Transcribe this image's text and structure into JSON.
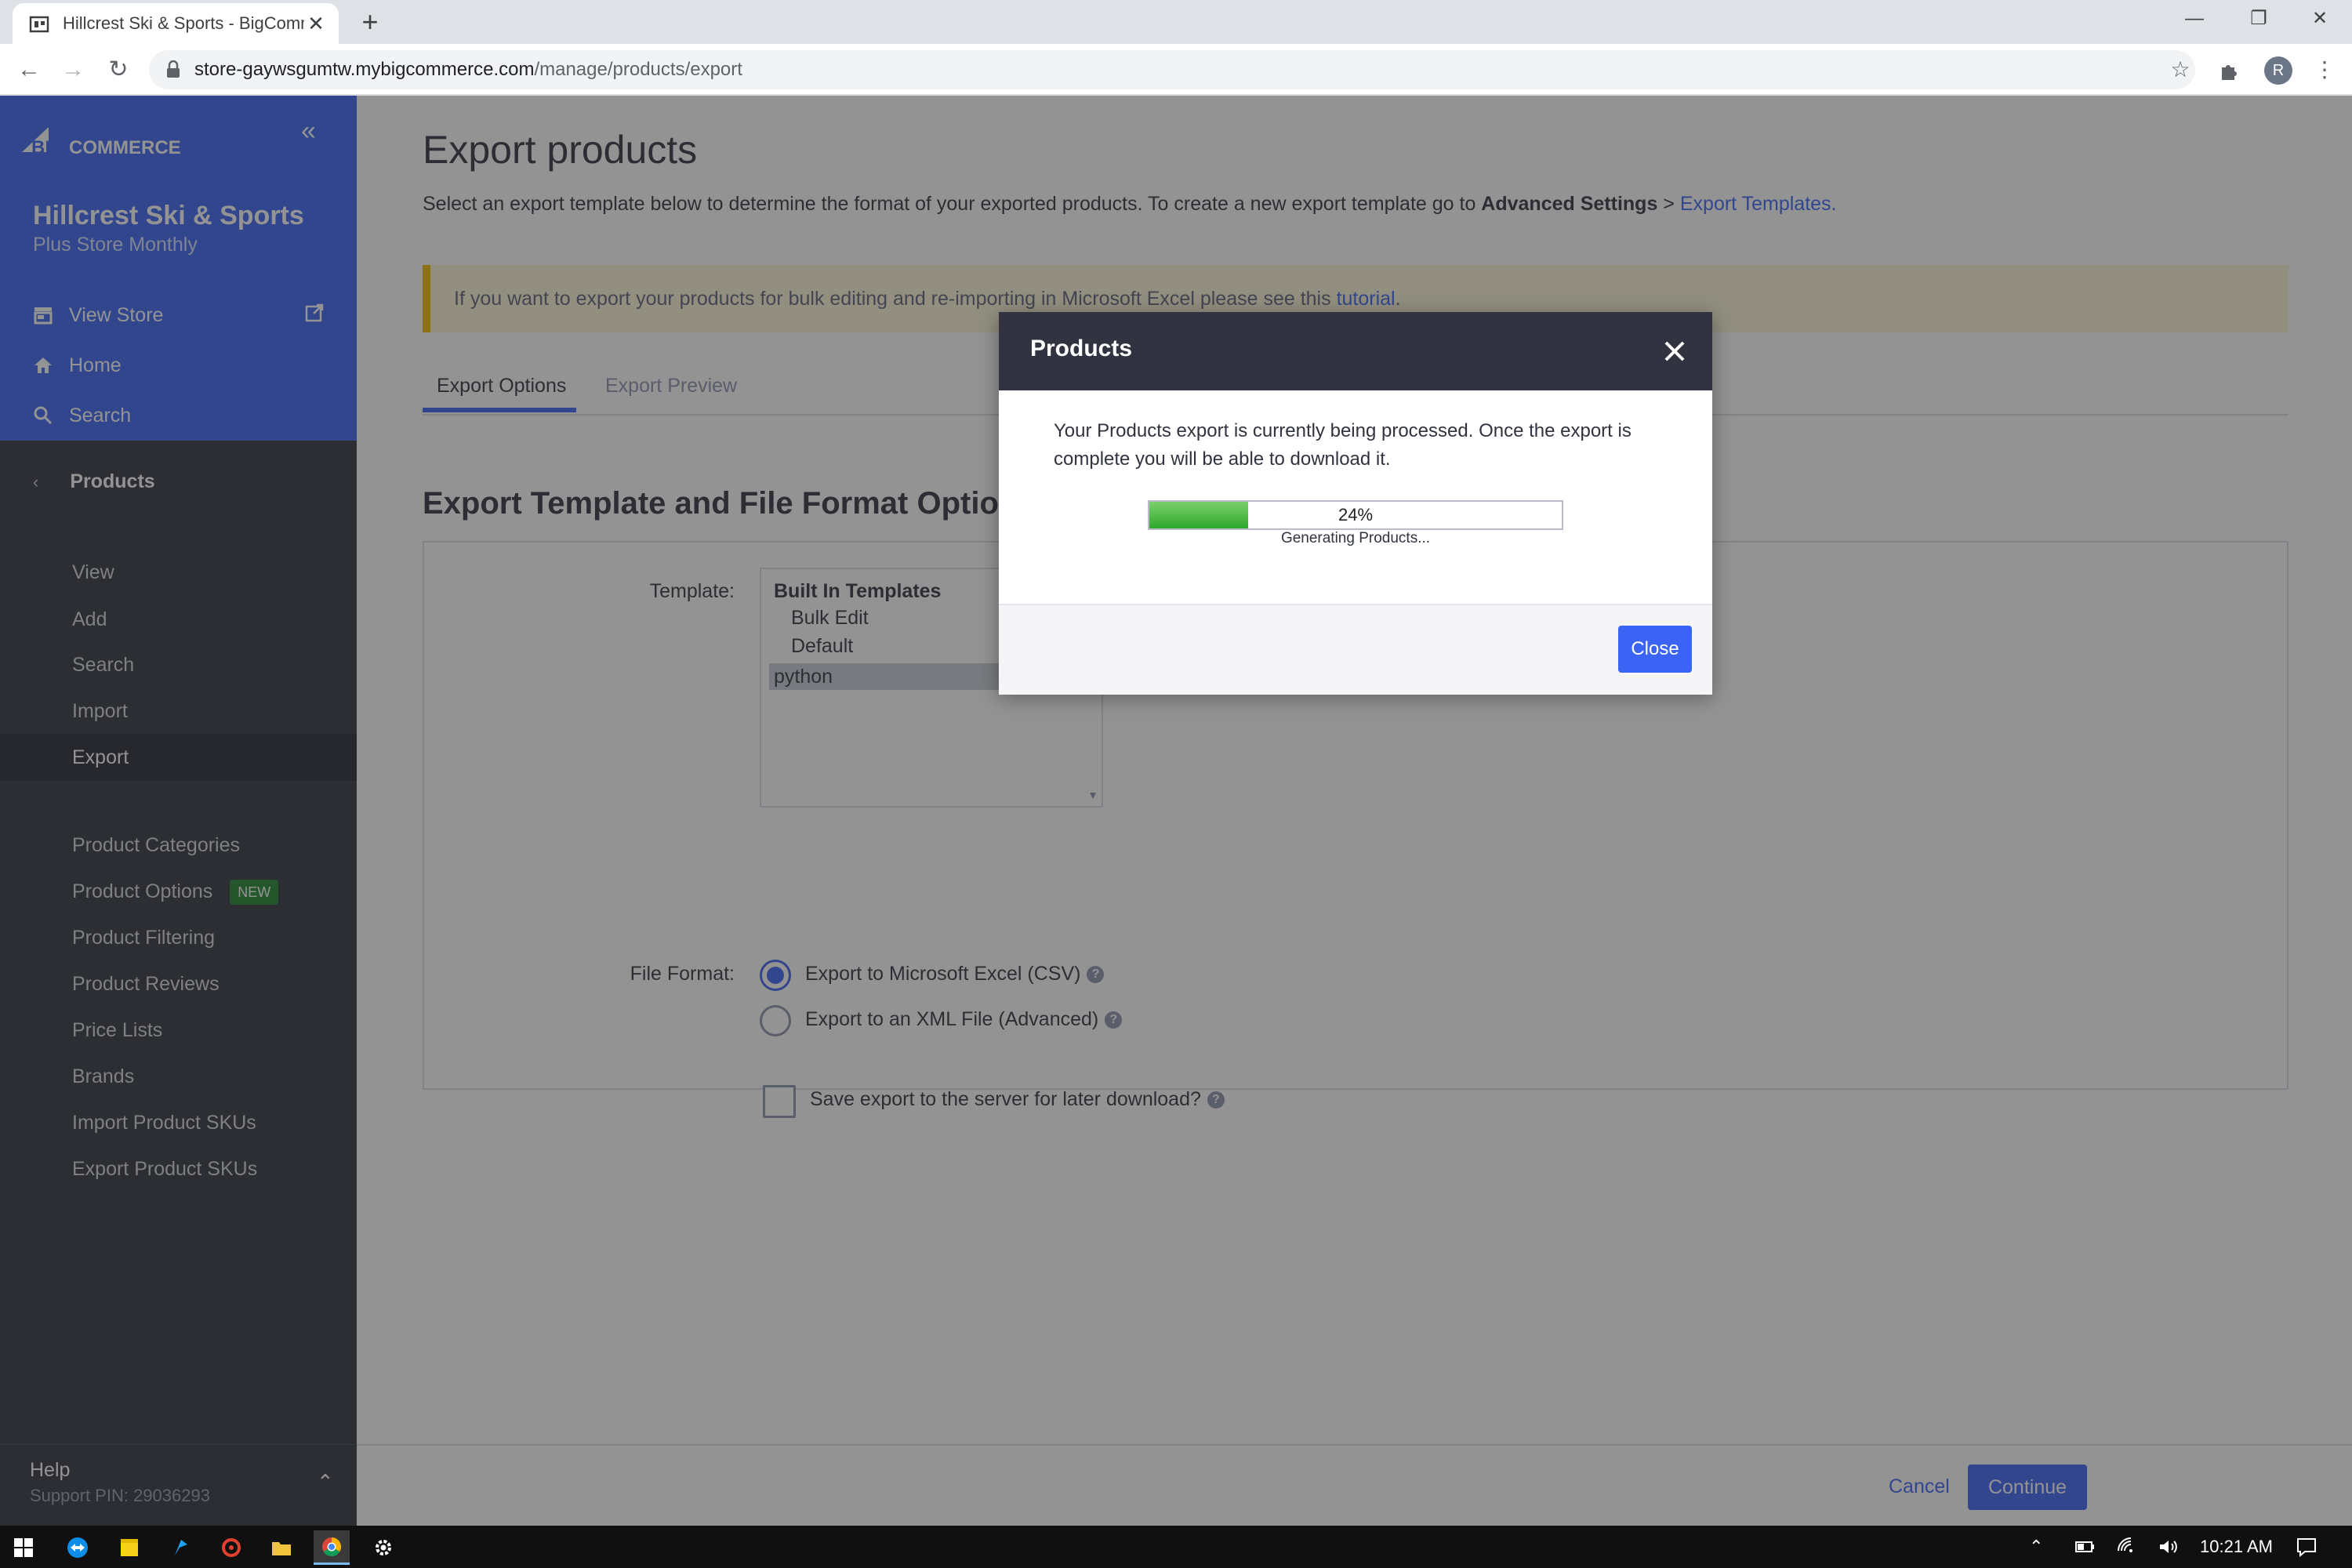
{
  "browser": {
    "tab_title": "Hillcrest Ski & Sports - BigComm",
    "url_host": "store-gaywsgumtw.mybigcommerce.com",
    "url_path": "/manage/products/export",
    "profile_initial": "R"
  },
  "sidebar": {
    "logo_text": "BIGCOMMERCE",
    "store_name": "Hillcrest Ski & Sports",
    "store_plan": "Plus Store Monthly",
    "top_links": [
      "View Store",
      "Home",
      "Search"
    ],
    "section_title": "Products",
    "items": [
      "View",
      "Add",
      "Search",
      "Import",
      "Export"
    ],
    "items2": [
      "Product Categories",
      "Product Options",
      "Product Filtering",
      "Product Reviews",
      "Price Lists",
      "Brands",
      "Import Product SKUs",
      "Export Product SKUs"
    ],
    "new_badge": "NEW",
    "help_title": "Help",
    "support_pin": "Support PIN: 29036293"
  },
  "main": {
    "title": "Export products",
    "desc_start": "Select an export template below to determine the format of your exported products. To create a new export template go to ",
    "desc_bold": "Advanced Settings",
    "desc_sep": " > ",
    "desc_link": "Export Templates.",
    "notice_text": "If you want to export your products for bulk editing and re-importing in Microsoft Excel please see this ",
    "notice_link": "tutorial",
    "notice_end": ".",
    "tab_options": "Export Options",
    "tab_preview": "Export Preview",
    "section_title": "Export Template and File Format Options",
    "template_label": "Template:",
    "template_group": "Built In Templates",
    "template_options": [
      "Bulk Edit",
      "Default"
    ],
    "template_selected": "python",
    "file_format_label": "File Format:",
    "format_csv": "Export to Microsoft Excel (CSV)",
    "format_xml": "Export to an XML File (Advanced)",
    "save_server": "Save export to the server for later download?",
    "cancel": "Cancel",
    "continue": "Continue"
  },
  "modal": {
    "title": "Products",
    "message": "Your Products export is currently being processed. Once the export is complete you will be able to download it.",
    "progress_percent": 24,
    "progress_label": "24%",
    "status": "Generating Products...",
    "close_button": "Close"
  },
  "taskbar": {
    "clock": "10:21 AM"
  },
  "colors": {
    "brand_blue": "#3c64f4",
    "sidebar_dark": "#313440",
    "progress_green": "#2fa82b",
    "notice_yellow": "#fdf6d8"
  }
}
